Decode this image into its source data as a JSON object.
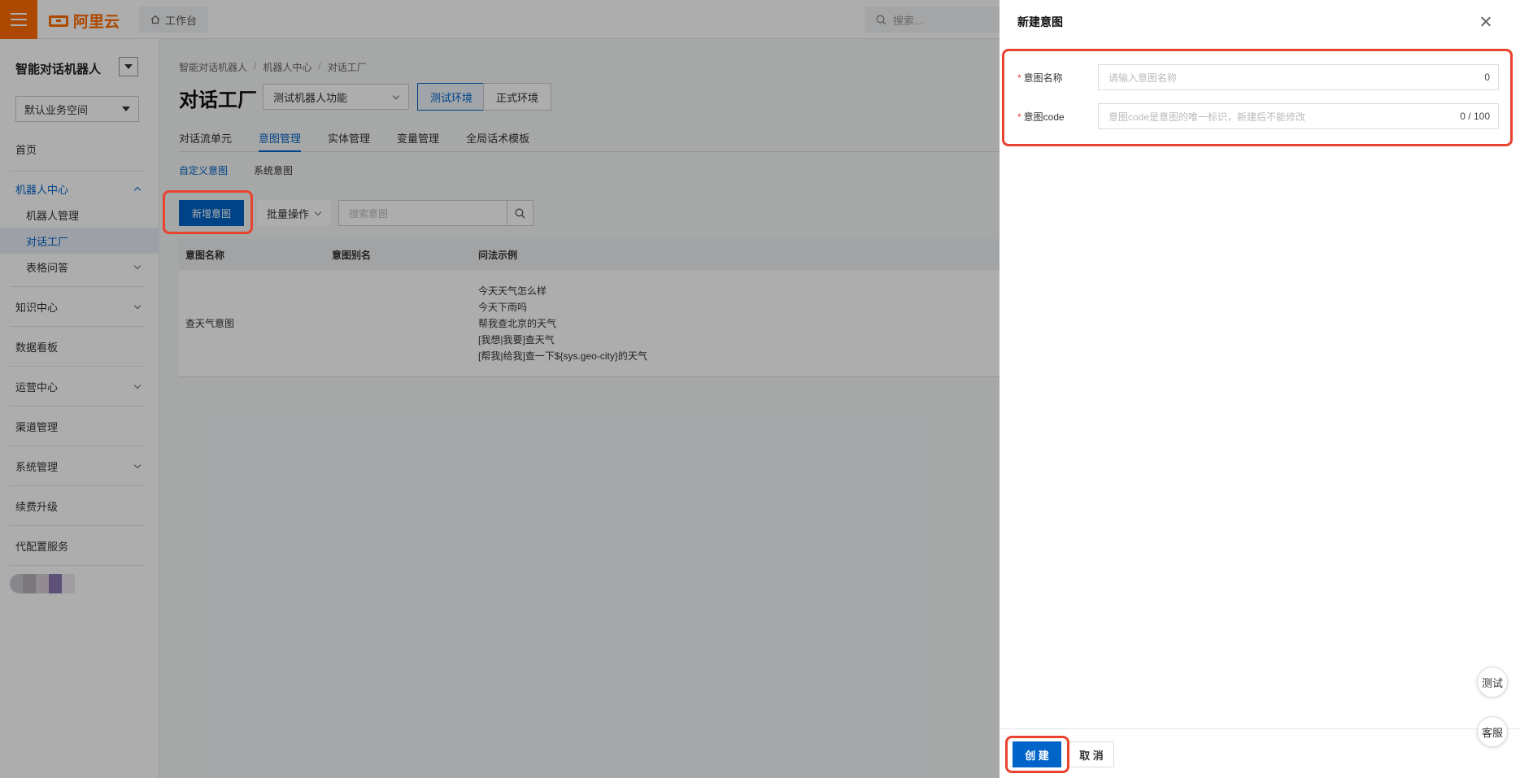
{
  "topbar": {
    "logo_text": "阿里云",
    "workbench_label": "工作台",
    "search_placeholder": "搜索..."
  },
  "sidebar": {
    "title": "智能对话机器人",
    "workspace": "默认业务空间",
    "items": {
      "home": "首页",
      "robot_center": "机器人中心",
      "robot_manage": "机器人管理",
      "dialog_factory": "对话工厂",
      "table_qa": "表格问答",
      "knowledge_center": "知识中心",
      "data_board": "数据看板",
      "ops_center": "运营中心",
      "channel_manage": "渠道管理",
      "system_manage": "系统管理",
      "renew_upgrade": "续费升级",
      "config_service": "代配置服务"
    }
  },
  "main": {
    "breadcrumb": [
      "智能对话机器人",
      "机器人中心",
      "对话工厂"
    ],
    "breadcrumb_sep": "/",
    "title": "对话工厂",
    "robot_select": "测试机器人功能",
    "env_test": "测试环境",
    "env_prod": "正式环境",
    "tabs": [
      "对话流单元",
      "意图管理",
      "实体管理",
      "变量管理",
      "全局话术模板"
    ],
    "subtabs": [
      "自定义意图",
      "系统意图"
    ],
    "new_intent_button": "新增意图",
    "batch_button": "批量操作",
    "search_placeholder": "搜索意图",
    "table": {
      "headers": [
        "意图名称",
        "意图别名",
        "问法示例"
      ],
      "rows": [
        {
          "name": "查天气意图",
          "alias": "",
          "examples": [
            "今天天气怎么样",
            "今天下雨吗",
            "帮我查北京的天气",
            "[我想|我要]查天气",
            "[帮我|给我]查一下${sys.geo-city}的天气"
          ]
        }
      ]
    }
  },
  "drawer": {
    "title": "新建意图",
    "name_label": "意图名称",
    "name_placeholder": "请输入意图名称",
    "name_count": "0",
    "code_label": "意图code",
    "code_placeholder": "意图code是意图的唯一标识，新建后不能修改",
    "code_count": "0 / 100",
    "create_button": "创 建",
    "cancel_button": "取 消"
  },
  "floating": {
    "test": "测试",
    "service": "客服"
  },
  "colors": {
    "brand_orange": "#ff6a00",
    "primary_blue": "#0064c8",
    "highlight_red": "#e8432e"
  }
}
